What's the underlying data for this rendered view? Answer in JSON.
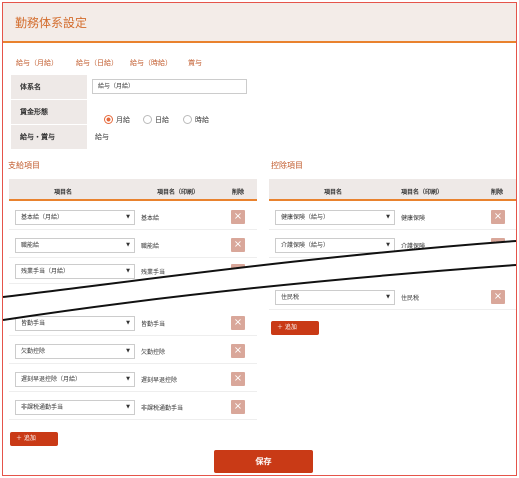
{
  "header": {
    "title": "勤務体系設定"
  },
  "tabs": [
    "給与（月給）",
    "給与（日給）",
    "給与（時給）",
    "賞与"
  ],
  "basic": {
    "name_label": "体系名",
    "name_value": "給与（月給）",
    "wage_label": "賃金形態",
    "wage_options": [
      "月給",
      "日給",
      "時給"
    ],
    "wage_selected": "月給",
    "type_label": "給与・賞与",
    "type_value": "給与"
  },
  "payment": {
    "title": "支給項目",
    "headers": [
      "項目名",
      "項目名（印刷）",
      "削除"
    ],
    "rows": [
      {
        "item": "基本給（月給）",
        "print": "基本給"
      },
      {
        "item": "職能給",
        "print": "職能給"
      },
      {
        "item": "残業手当（月給）",
        "print": "残業手当"
      },
      {
        "item": "皆勤手当",
        "print": "皆勤手当"
      },
      {
        "item": "欠勤控除",
        "print": "欠勤控除"
      },
      {
        "item": "遅刻早退控除（月給）",
        "print": "遅刻早退控除"
      },
      {
        "item": "非課税通勤手当",
        "print": "非課税通勤手当"
      }
    ],
    "add_label": "追加"
  },
  "deduction": {
    "title": "控除項目",
    "headers": [
      "項目名",
      "項目名（印刷）",
      "削除"
    ],
    "rows": [
      {
        "item": "健康保険（給与）",
        "print": "健康保険"
      },
      {
        "item": "介護保険（給与）",
        "print": "介護保険"
      },
      {
        "item": "住民税",
        "print": "住民税"
      }
    ],
    "add_label": "追加"
  },
  "save_label": "保存",
  "icons": {
    "delete": "close-icon",
    "dropdown": "chevron-down-icon",
    "add": "plus-icon"
  }
}
